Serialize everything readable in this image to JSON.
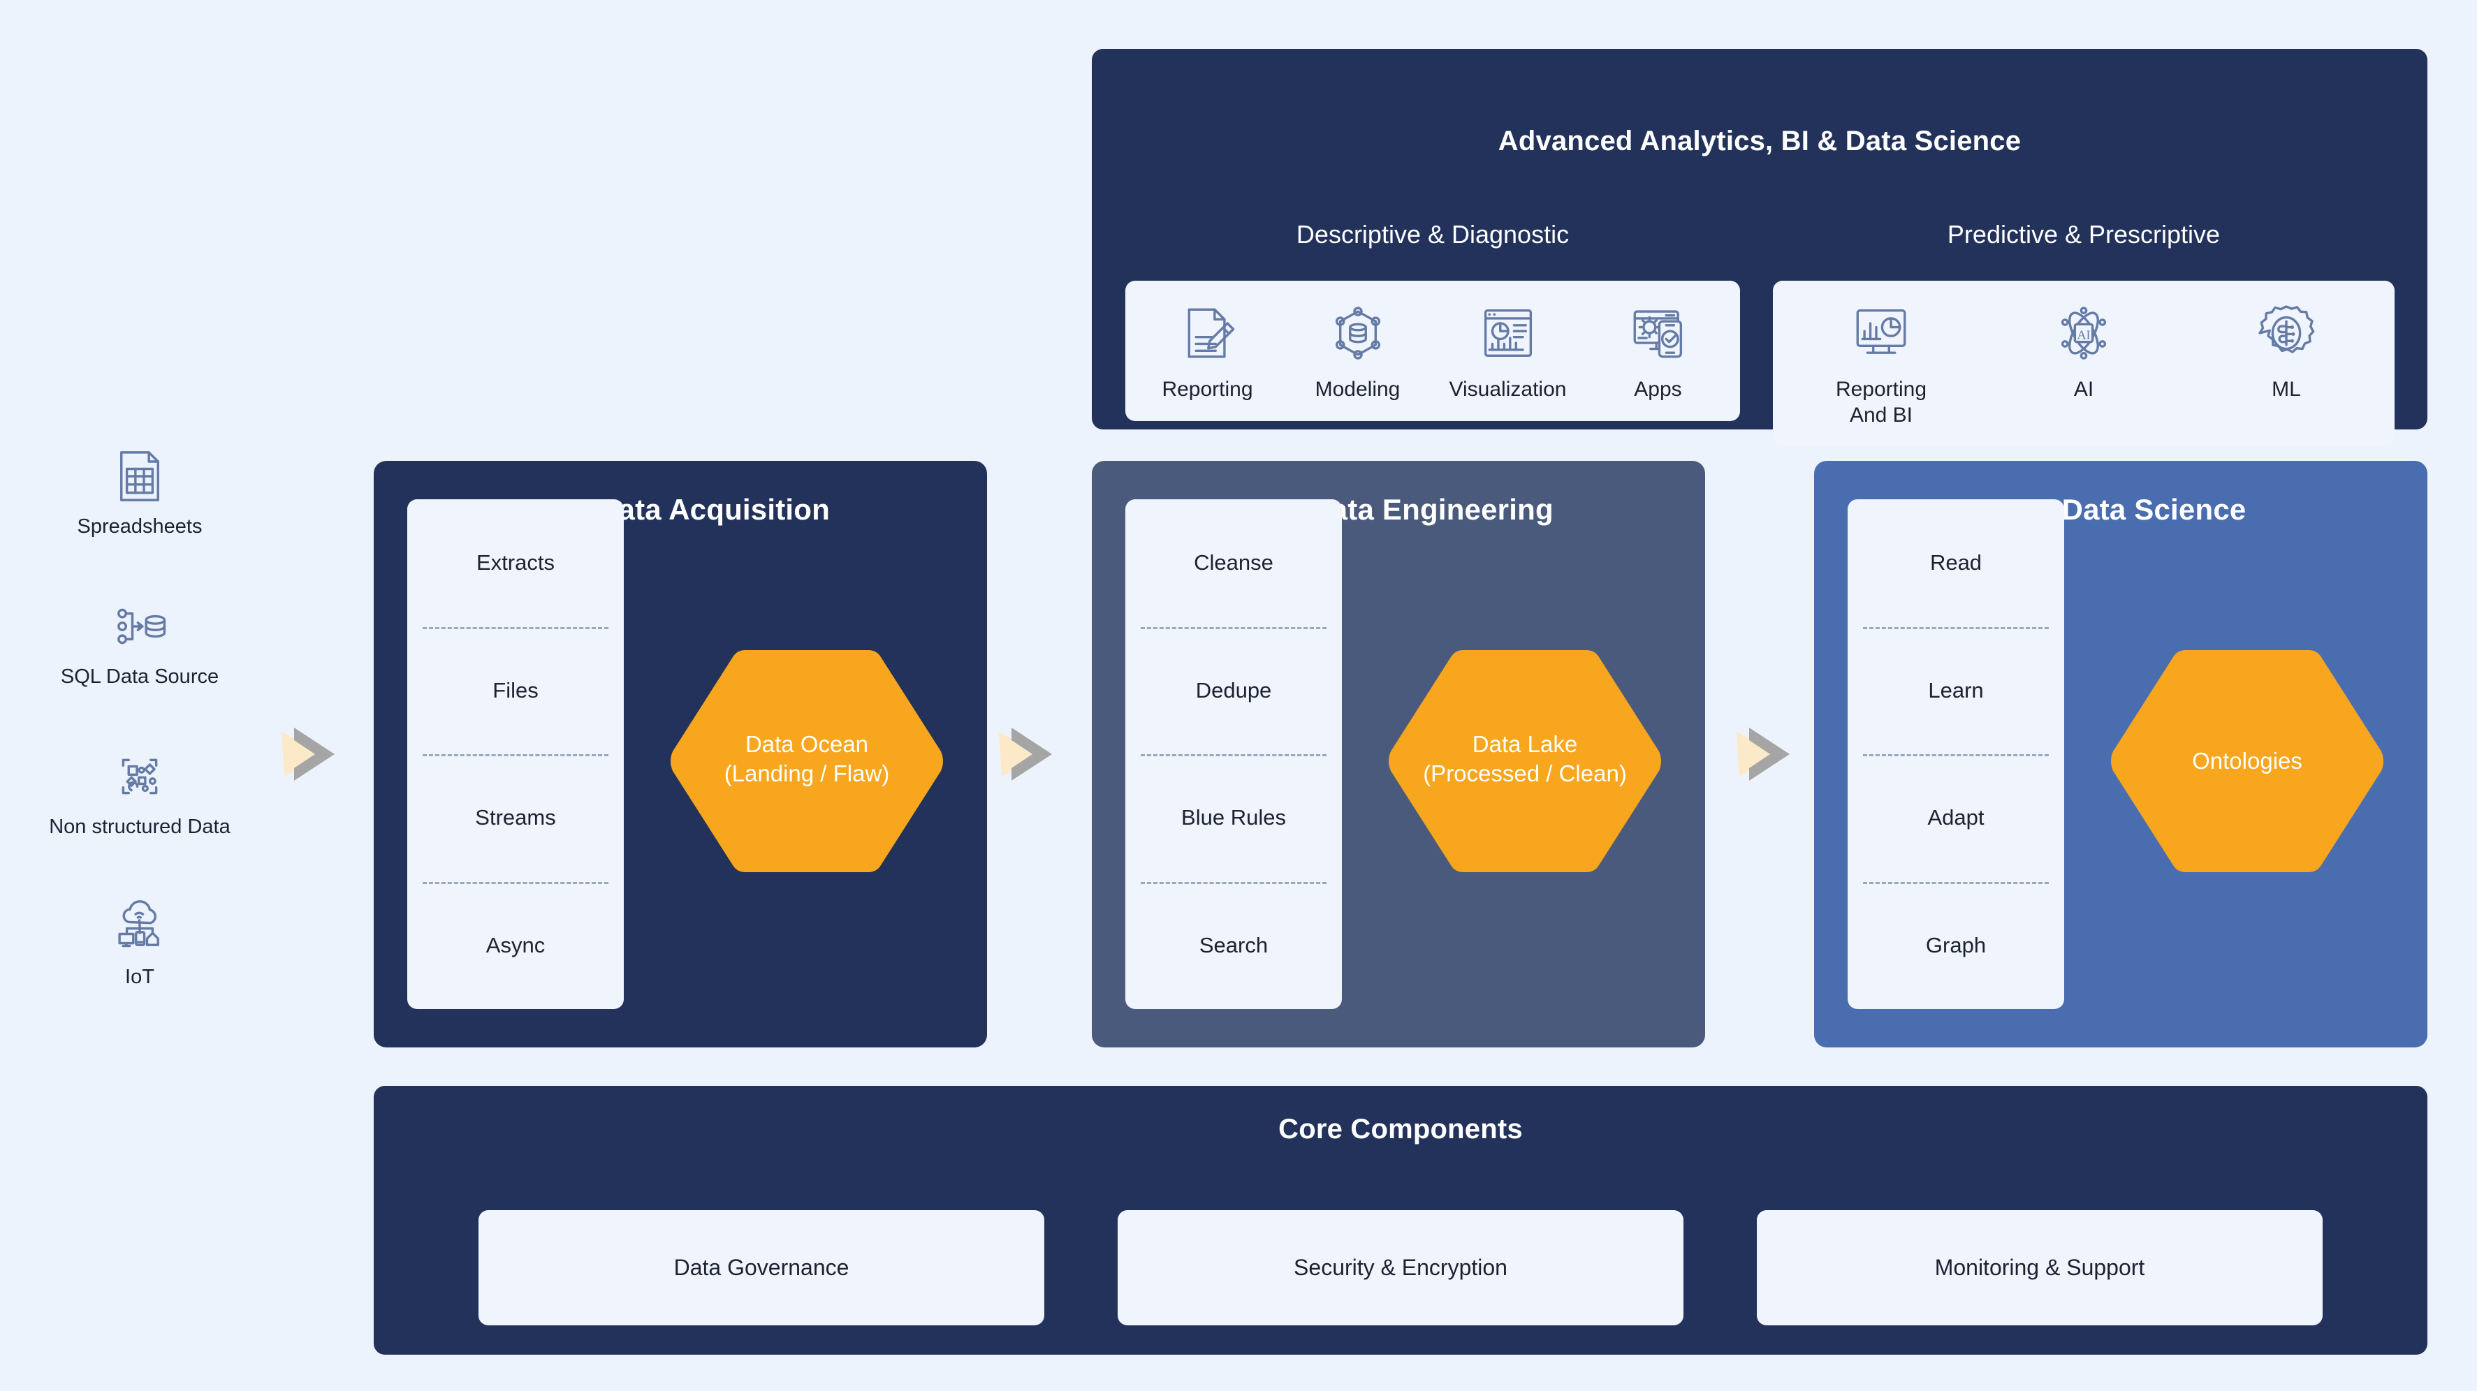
{
  "colors": {
    "background": "#edf3fd",
    "navy": "#22325a",
    "slate": "#4a5a7c",
    "blue": "#4a6db0",
    "orange": "#f7a61e",
    "card": "#eff4fd",
    "icon_stroke": "#657ba6",
    "arrow_gray": "#a5a5a5",
    "arrow_cream": "#fce9c8",
    "dashed_divider": "#9aa7bd"
  },
  "sources": {
    "items": [
      {
        "label": "Spreadsheets",
        "icon": "spreadsheet-icon"
      },
      {
        "label": "SQL Data Source",
        "icon": "sql-database-icon"
      },
      {
        "label": "Non structured Data",
        "icon": "unstructured-data-icon"
      },
      {
        "label": "IoT",
        "icon": "iot-cloud-icon"
      }
    ]
  },
  "analytics": {
    "title": "Advanced Analytics, BI & Data Science",
    "groups": [
      {
        "title": "Descriptive & Diagnostic",
        "capabilities": [
          {
            "label": "Reporting",
            "icon": "document-edit-icon"
          },
          {
            "label": "Modeling",
            "icon": "data-model-network-icon"
          },
          {
            "label": "Visualization",
            "icon": "dashboard-chart-icon"
          },
          {
            "label": "Apps",
            "icon": "apps-device-icon"
          }
        ]
      },
      {
        "title": "Predictive & Prescriptive",
        "capabilities": [
          {
            "label": "Reporting\nAnd BI",
            "icon": "monitor-analytics-icon"
          },
          {
            "label": "AI",
            "icon": "ai-atom-icon"
          },
          {
            "label": "ML",
            "icon": "ml-brain-gear-icon"
          }
        ]
      }
    ]
  },
  "stages": [
    {
      "title": "Data Acquisition",
      "steps": [
        "Extracts",
        "Files",
        "Streams",
        "Async"
      ],
      "hexagon": {
        "line1": "Data Ocean",
        "line2": "(Landing / Flaw)"
      }
    },
    {
      "title": "Data Engineering",
      "steps": [
        "Cleanse",
        "Dedupe",
        "Blue Rules",
        "Search"
      ],
      "hexagon": {
        "line1": "Data Lake",
        "line2": "(Processed / Clean)"
      }
    },
    {
      "title": "Data Science",
      "steps": [
        "Read",
        "Learn",
        "Adapt",
        "Graph"
      ],
      "hexagon": {
        "line1": "Ontologies",
        "line2": ""
      }
    }
  ],
  "core": {
    "title": "Core Components",
    "items": [
      "Data Governance",
      "Security & Encryption",
      "Monitoring & Support"
    ]
  },
  "arrows": [
    {
      "name": "arrow-sources-to-acquisition"
    },
    {
      "name": "arrow-acquisition-to-engineering"
    },
    {
      "name": "arrow-engineering-to-science"
    }
  ]
}
